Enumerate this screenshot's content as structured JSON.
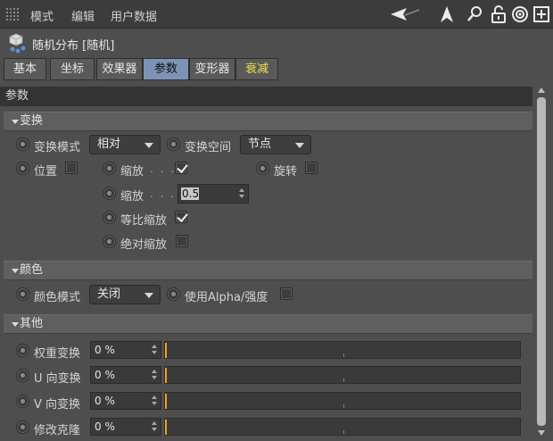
{
  "menu": {
    "items": [
      "模式",
      "编辑",
      "用户数据"
    ],
    "icons": [
      "back-arrow-icon",
      "navigate-icon",
      "search-icon",
      "lock-icon",
      "target-icon",
      "add-panel-icon"
    ]
  },
  "object": {
    "title": "随机分布 [随机]",
    "icon": "random-effector-icon"
  },
  "tabs": [
    {
      "label": "基本",
      "state": "normal"
    },
    {
      "label": "坐标",
      "state": "normal"
    },
    {
      "label": "效果器",
      "state": "normal"
    },
    {
      "label": "参数",
      "state": "active"
    },
    {
      "label": "变形器",
      "state": "normal"
    },
    {
      "label": "衰减",
      "state": "highlight"
    }
  ],
  "params_header": "参数",
  "sections": {
    "transform": {
      "title": "变换",
      "mode_label": "变换模式",
      "mode_value": "相对",
      "space_label": "变换空间",
      "space_value": "节点",
      "position_label": "位置",
      "position_checked": false,
      "scale_label": "缩放",
      "scale_dots": ". . .",
      "scale_checked": true,
      "rotation_label": "旋转",
      "rotation_checked": false,
      "scale_value_label": "缩放",
      "scale_value_dots": ". . .",
      "scale_value": "0.5",
      "uniform_label": "等比缩放",
      "uniform_checked": true,
      "absolute_label": "绝对缩放",
      "absolute_checked": false
    },
    "color": {
      "title": "颜色",
      "mode_label": "颜色模式",
      "mode_value": "关闭",
      "alpha_label": "使用Alpha/强度",
      "alpha_checked": false
    },
    "other": {
      "title": "其他",
      "rows": [
        {
          "label": "权重变换",
          "value": "0 %",
          "fraction": 0
        },
        {
          "label": "U 向变换",
          "value": "0 %",
          "fraction": 0
        },
        {
          "label": "V 向变换",
          "value": "0 %",
          "fraction": 0
        },
        {
          "label": "修改克隆",
          "value": "0 %",
          "fraction": 0
        }
      ]
    }
  },
  "colors": {
    "active_tab": "#7d93b5",
    "highlight_tab_text": "#f2e04a",
    "slider_handle": "#f0a020"
  }
}
